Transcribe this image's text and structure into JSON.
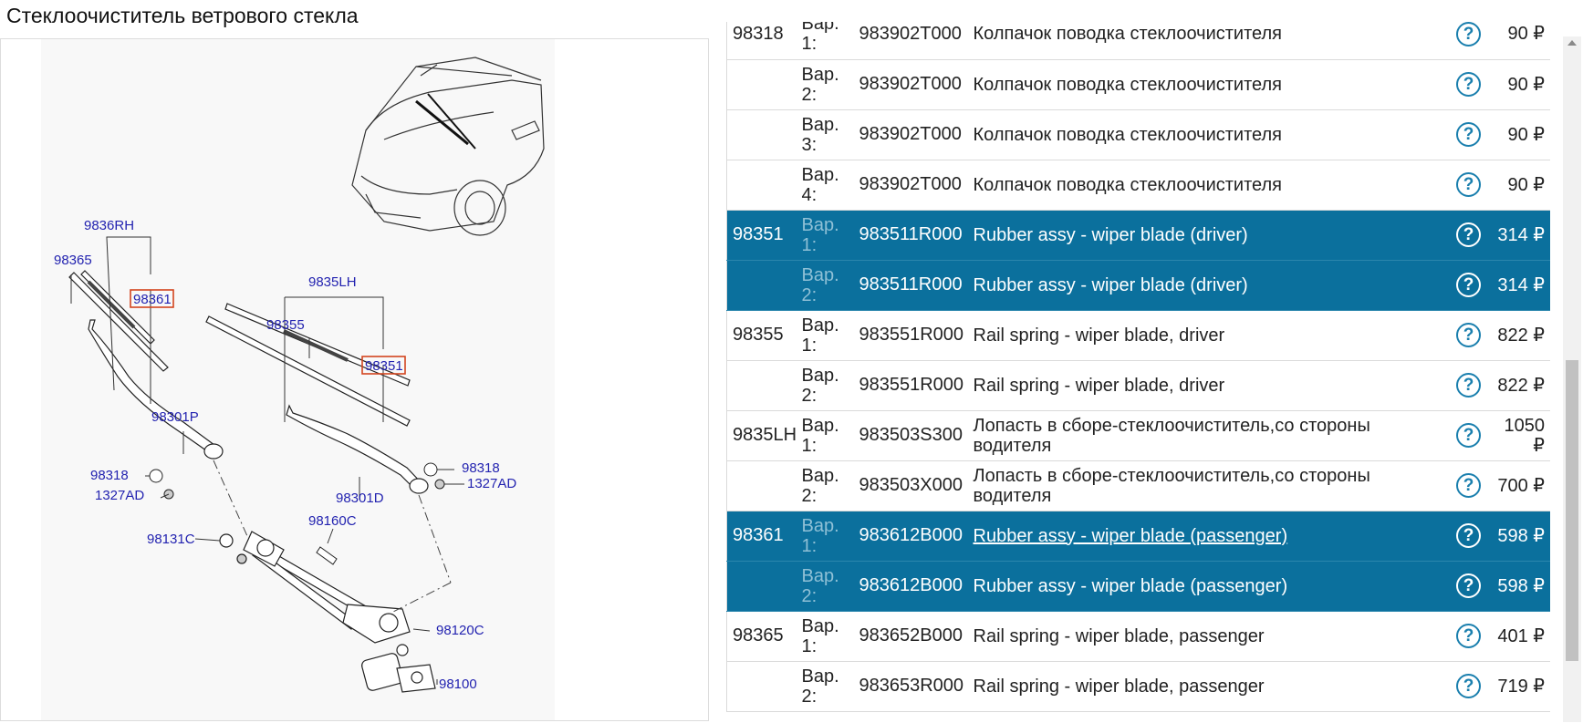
{
  "page": {
    "title": "Стеклоочиститель ветрового стекла"
  },
  "diagram": {
    "labels": {
      "l9836RH": "9836RH",
      "l98365": "98365",
      "l98361": "98361",
      "l9835LH": "9835LH",
      "l98355": "98355",
      "l98351": "98351",
      "l98301P": "98301P",
      "l98318a": "98318",
      "l1327ADa": "1327AD",
      "l98318b": "98318",
      "l1327ADb": "1327AD",
      "l98301D": "98301D",
      "l98160C": "98160C",
      "l98131C": "98131C",
      "l98120C": "98120C",
      "l98100": "98100"
    },
    "highlighted_callouts": [
      "98361",
      "98351"
    ],
    "colors": {
      "label": "#2323b0",
      "highlight_box": "#d2451e",
      "line": "#222222",
      "background": "#f8f8f8"
    }
  },
  "parts_table": {
    "currency": "₽",
    "help_icon": "help-circle-icon",
    "highlight_color": "#0b709d",
    "rows": [
      {
        "num": "98318",
        "variant": "Вар. 1:",
        "code": "983902T000",
        "name": "Колпачок поводка стеклоочистителя",
        "price": "90 ₽",
        "highlight": false,
        "underline": false
      },
      {
        "num": "",
        "variant": "Вар. 2:",
        "code": "983902T000",
        "name": "Колпачок поводка стеклоочистителя",
        "price": "90 ₽",
        "highlight": false,
        "underline": false
      },
      {
        "num": "",
        "variant": "Вар. 3:",
        "code": "983902T000",
        "name": "Колпачок поводка стеклоочистителя",
        "price": "90 ₽",
        "highlight": false,
        "underline": false
      },
      {
        "num": "",
        "variant": "Вар. 4:",
        "code": "983902T000",
        "name": "Колпачок поводка стеклоочистителя",
        "price": "90 ₽",
        "highlight": false,
        "underline": false
      },
      {
        "num": "98351",
        "variant": "Вар. 1:",
        "code": "983511R000",
        "name": "Rubber assy - wiper blade (driver)",
        "price": "314 ₽",
        "highlight": true,
        "underline": false
      },
      {
        "num": "",
        "variant": "Вар. 2:",
        "code": "983511R000",
        "name": "Rubber assy - wiper blade (driver)",
        "price": "314 ₽",
        "highlight": true,
        "underline": false
      },
      {
        "num": "98355",
        "variant": "Вар. 1:",
        "code": "983551R000",
        "name": "Rail spring - wiper blade, driver",
        "price": "822 ₽",
        "highlight": false,
        "underline": false
      },
      {
        "num": "",
        "variant": "Вар. 2:",
        "code": "983551R000",
        "name": "Rail spring - wiper blade, driver",
        "price": "822 ₽",
        "highlight": false,
        "underline": false
      },
      {
        "num": "9835LH",
        "variant": "Вар. 1:",
        "code": "983503S300",
        "name": "Лопасть в сборе-стеклоочиститель,со стороны водителя",
        "price": "1050 ₽",
        "highlight": false,
        "underline": false
      },
      {
        "num": "",
        "variant": "Вар. 2:",
        "code": "983503X000",
        "name": "Лопасть в сборе-стеклоочиститель,со стороны водителя",
        "price": "700 ₽",
        "highlight": false,
        "underline": false
      },
      {
        "num": "98361",
        "variant": "Вар. 1:",
        "code": "983612B000",
        "name": "Rubber assy - wiper blade (passenger)",
        "price": "598 ₽",
        "highlight": true,
        "underline": true
      },
      {
        "num": "",
        "variant": "Вар. 2:",
        "code": "983612B000",
        "name": "Rubber assy - wiper blade (passenger)",
        "price": "598 ₽",
        "highlight": true,
        "underline": false
      },
      {
        "num": "98365",
        "variant": "Вар. 1:",
        "code": "983652B000",
        "name": "Rail spring - wiper blade, passenger",
        "price": "401 ₽",
        "highlight": false,
        "underline": false
      },
      {
        "num": "",
        "variant": "Вар. 2:",
        "code": "983653R000",
        "name": "Rail spring - wiper blade, passenger",
        "price": "719 ₽",
        "highlight": false,
        "underline": false
      }
    ]
  }
}
